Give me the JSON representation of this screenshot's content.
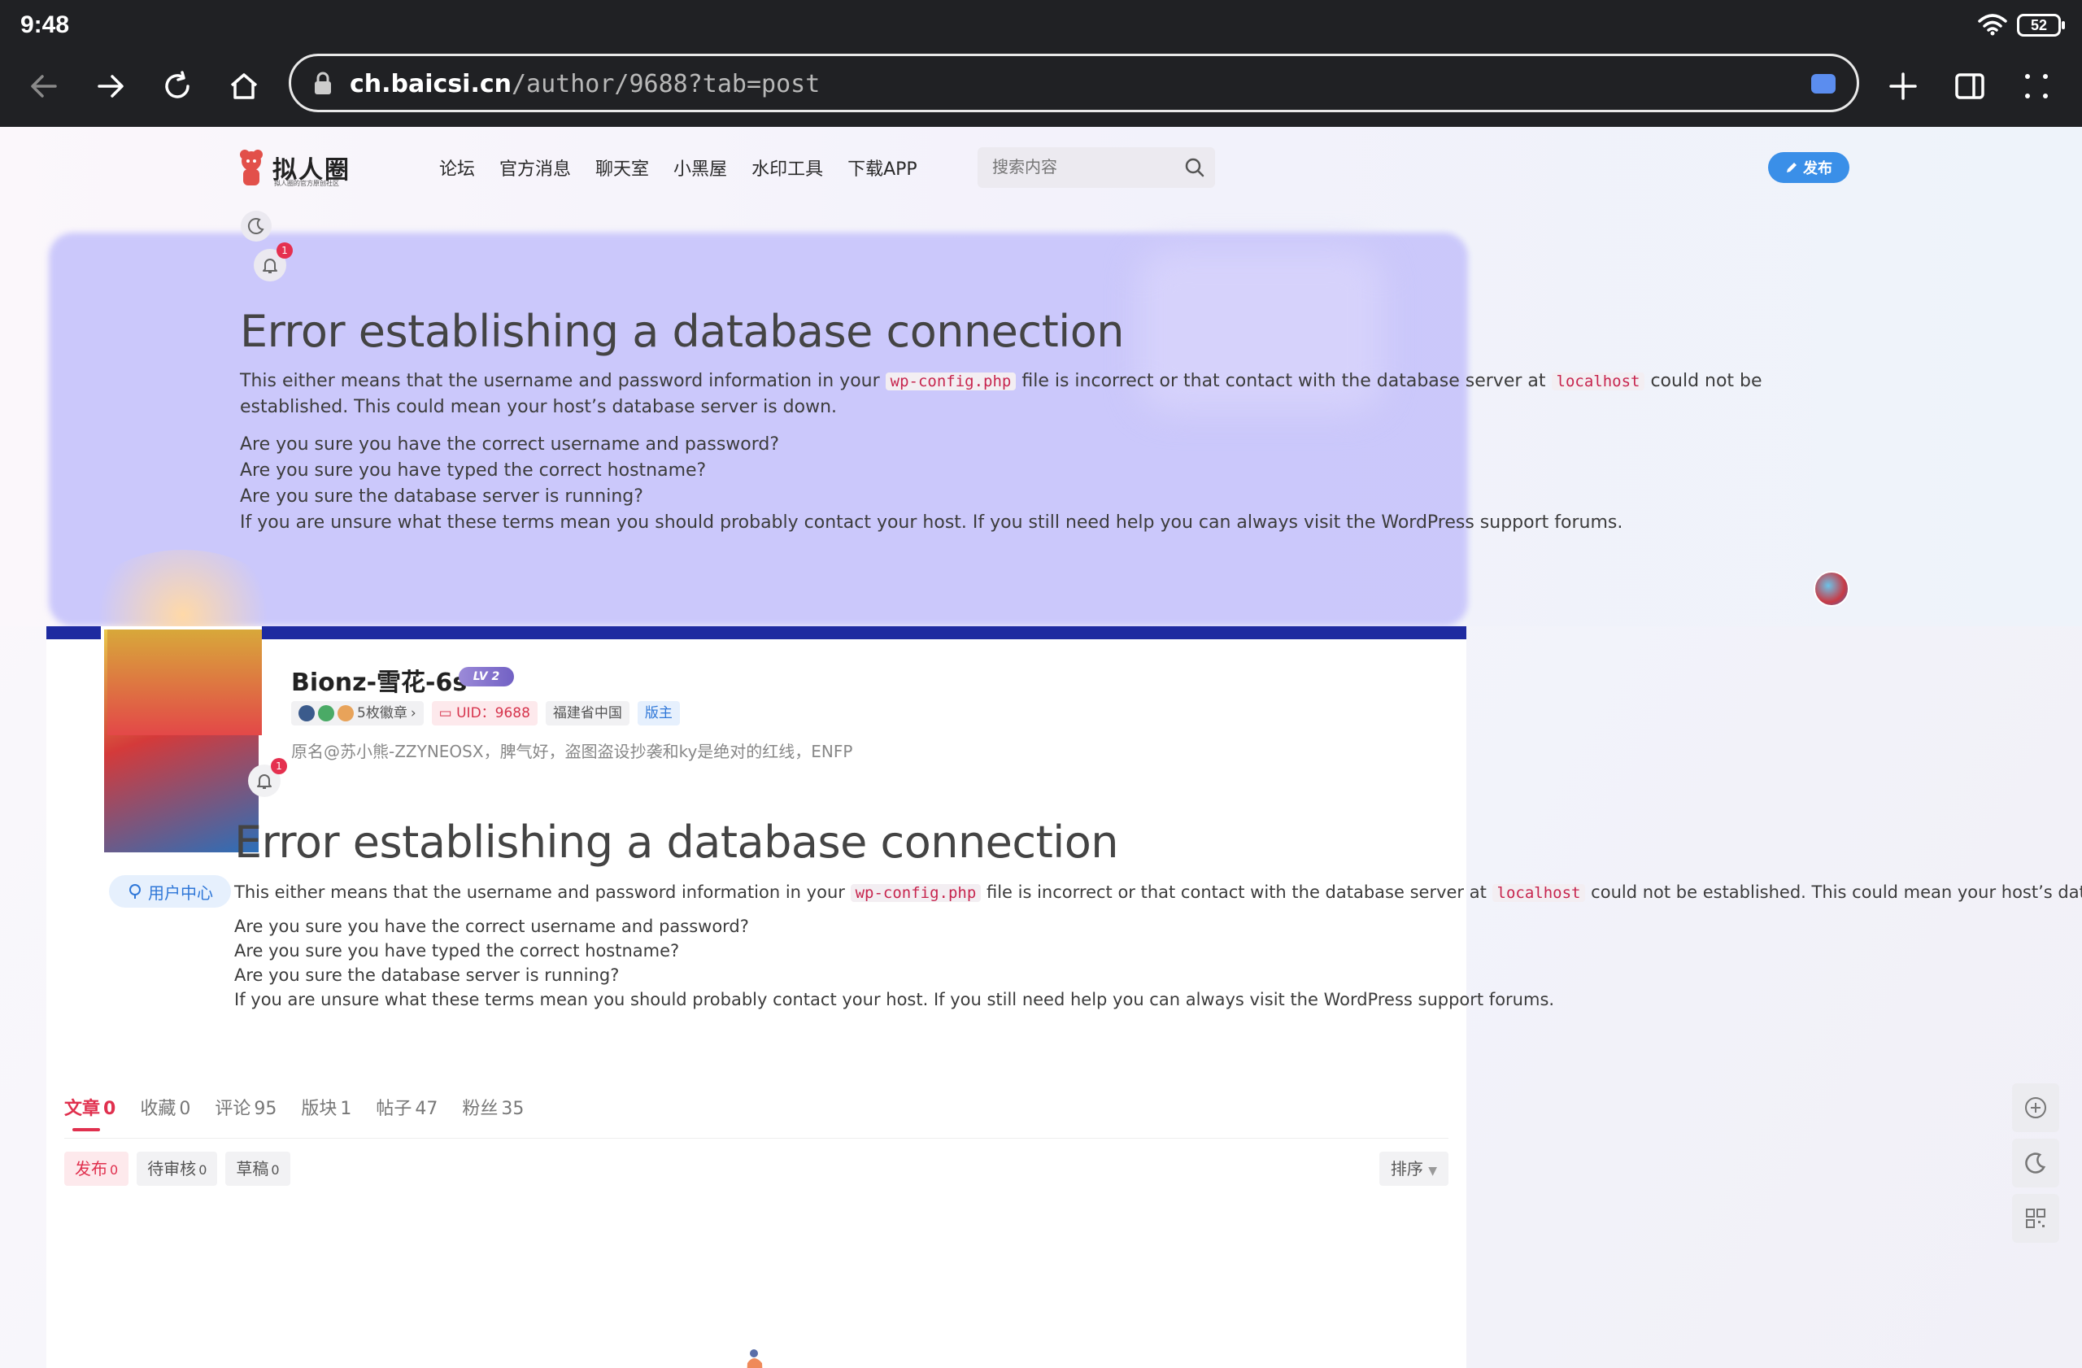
{
  "status_bar": {
    "time": "9:48",
    "battery": "52"
  },
  "browser": {
    "url_host": "ch.baicsi.cn",
    "url_path": "/author/9688?tab=post"
  },
  "header": {
    "logo_text": "拟人圈",
    "logo_subtitle": "拟人圈的官方原创社区",
    "nav": [
      "论坛",
      "官方消息",
      "聊天室",
      "小黑屋",
      "水印工具",
      "下载APP"
    ],
    "search_placeholder": "搜索内容",
    "publish_label": "发布",
    "bell_count": "1"
  },
  "error": {
    "title": "Error establishing a database connection",
    "p_part1": "This either means that the username and password information in your",
    "code1": "wp-config.php",
    "p_part2": "file is incorrect or that contact with the database server at",
    "code2": "localhost",
    "p_part3": "could not be established. This could mean your host’s database server is down.",
    "list": [
      "Are you sure you have the correct username and password?",
      "Are you sure you have typed the correct hostname?",
      "Are you sure the database server is running?",
      "If you are unsure what these terms mean you should probably contact your host. If you still need help you can always visit the WordPress support forums."
    ]
  },
  "profile": {
    "name": "Bionz-雪花-6s",
    "level": "LV 2",
    "badges_label": "5枚徽章",
    "uid_label": "UID：",
    "uid": "9688",
    "location": "福建省中国",
    "role": "版主",
    "bio": "原名@苏小熊-ZZYNEOSX，脾气好，盗图盗设抄袭和ky是绝对的红线，ENFP",
    "bell_count": "1",
    "user_center_label": "用户中心"
  },
  "tabs": [
    {
      "label": "文章",
      "count": "0",
      "active": true
    },
    {
      "label": "收藏",
      "count": "0"
    },
    {
      "label": "评论",
      "count": "95"
    },
    {
      "label": "版块",
      "count": "1"
    },
    {
      "label": "帖子",
      "count": "47"
    },
    {
      "label": "粉丝",
      "count": "35"
    }
  ],
  "subtabs": [
    {
      "label": "发布",
      "count": "0",
      "active": true
    },
    {
      "label": "待审核",
      "count": "0"
    },
    {
      "label": "草稿",
      "count": "0"
    }
  ],
  "sort_label": "排序",
  "colors": {
    "accent": "#e0304e",
    "blue": "#3a8fe8",
    "overlay_purple": "#c9c6fb"
  }
}
